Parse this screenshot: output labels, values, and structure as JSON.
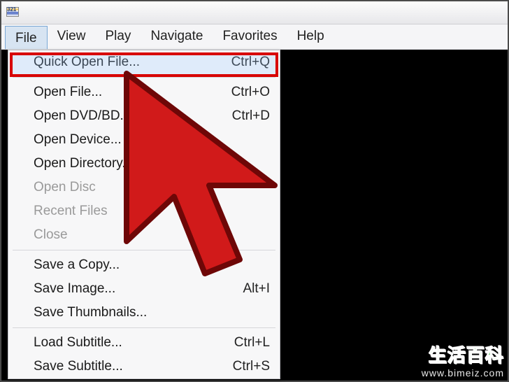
{
  "titlebar": {
    "icon_text": "321"
  },
  "menubar": {
    "items": [
      "File",
      "View",
      "Play",
      "Navigate",
      "Favorites",
      "Help"
    ],
    "open_index": 0
  },
  "file_menu": {
    "items": [
      {
        "label": "Quick Open File...",
        "shortcut": "Ctrl+Q",
        "enabled": true,
        "highlighted": true
      },
      {
        "separator": true
      },
      {
        "label": "Open File...",
        "shortcut": "Ctrl+O",
        "enabled": true
      },
      {
        "label": "Open DVD/BD...",
        "shortcut": "Ctrl+D",
        "enabled": true
      },
      {
        "label": "Open Device...",
        "shortcut": "",
        "enabled": true
      },
      {
        "label": "Open Directory...",
        "shortcut": "",
        "enabled": true
      },
      {
        "label": "Open Disc",
        "shortcut": "",
        "enabled": false
      },
      {
        "label": "Recent Files",
        "shortcut": "",
        "enabled": false
      },
      {
        "label": "Close",
        "shortcut": "",
        "enabled": false
      },
      {
        "separator": true
      },
      {
        "label": "Save a Copy...",
        "shortcut": "",
        "enabled": true
      },
      {
        "label": "Save Image...",
        "shortcut": "Alt+I",
        "enabled": true
      },
      {
        "label": "Save Thumbnails...",
        "shortcut": "",
        "enabled": true
      },
      {
        "separator": true
      },
      {
        "label": "Load Subtitle...",
        "shortcut": "Ctrl+L",
        "enabled": true
      },
      {
        "label": "Save Subtitle...",
        "shortcut": "Ctrl+S",
        "enabled": true
      }
    ]
  },
  "overlay": {
    "highlight_item_index": 0,
    "cursor_color_fill": "#d11a1a",
    "cursor_color_stroke": "#6e0707"
  },
  "watermark": {
    "title": "生活百科",
    "url": "www.bimeiz.com"
  }
}
